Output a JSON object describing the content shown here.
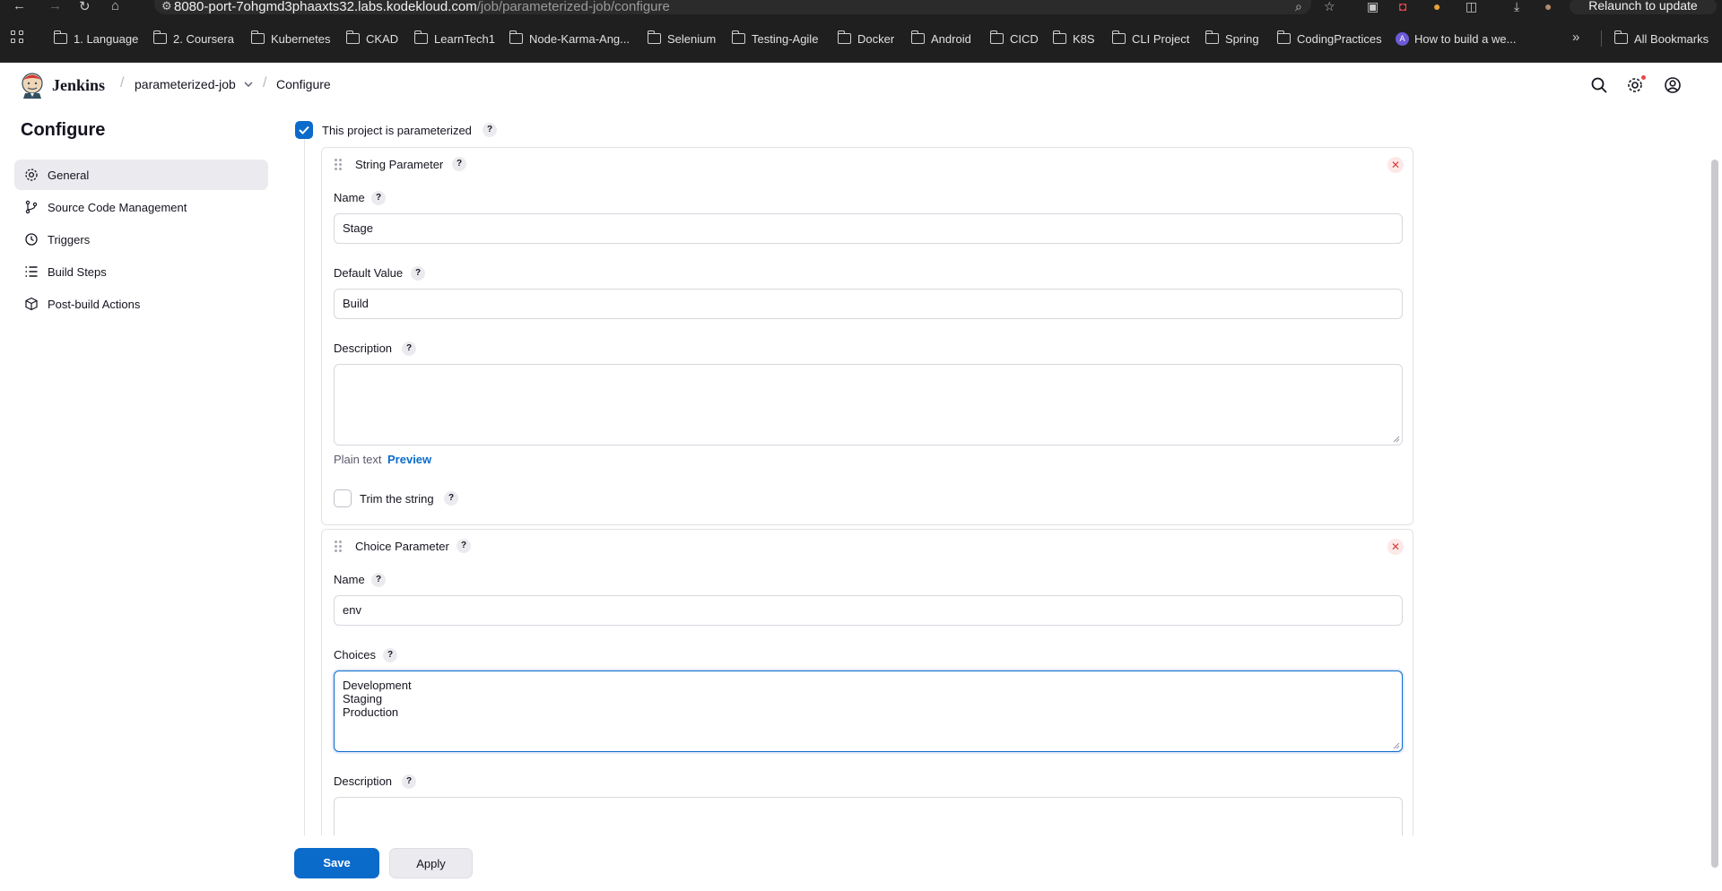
{
  "browser": {
    "url_host": "8080-port-7ohgmd3phaaxts32.labs.kodekloud.com",
    "url_path": "/job/parameterized-job/configure",
    "relaunch_label": "Relaunch to update",
    "bookmarks": [
      {
        "label": "1. Language"
      },
      {
        "label": "2. Coursera"
      },
      {
        "label": "Kubernetes"
      },
      {
        "label": "CKAD"
      },
      {
        "label": "LearnTech1"
      },
      {
        "label": "Node-Karma-Ang..."
      },
      {
        "label": "Selenium"
      },
      {
        "label": "Testing-Agile"
      },
      {
        "label": "Docker"
      },
      {
        "label": "Android"
      },
      {
        "label": "CICD"
      },
      {
        "label": "K8S"
      },
      {
        "label": "CLI Project"
      },
      {
        "label": "Spring"
      },
      {
        "label": "CodingPractices"
      },
      {
        "label": "How to build a we..."
      }
    ],
    "more_label": "»",
    "all_bookmarks_label": "All Bookmarks"
  },
  "header": {
    "brand": "Jenkins",
    "breadcrumb_job": "parameterized-job",
    "breadcrumb_page": "Configure",
    "notification_color": "#e5484d"
  },
  "sidebar": {
    "title": "Configure",
    "items": [
      {
        "label": "General",
        "icon": "gear-icon",
        "active": true
      },
      {
        "label": "Source Code Management",
        "icon": "branch-icon",
        "active": false
      },
      {
        "label": "Triggers",
        "icon": "clock-icon",
        "active": false
      },
      {
        "label": "Build Steps",
        "icon": "list-icon",
        "active": false
      },
      {
        "label": "Post-build Actions",
        "icon": "cube-icon",
        "active": false
      }
    ]
  },
  "main": {
    "parameterized_label": "This project is parameterized",
    "parameterized_checked": true,
    "help_glyph": "?",
    "delete_glyph": "✕",
    "string_param": {
      "title": "String Parameter",
      "name_label": "Name",
      "name_value": "Stage",
      "default_label": "Default Value",
      "default_value": "Build",
      "description_label": "Description",
      "description_value": "",
      "plain_text_label": "Plain text",
      "preview_label": "Preview",
      "trim_label": "Trim the string",
      "trim_checked": false
    },
    "choice_param": {
      "title": "Choice Parameter",
      "name_label": "Name",
      "name_value": "env",
      "choices_label": "Choices",
      "choices_value": "Development\nStaging\nProduction",
      "description_label": "Description",
      "description_value": ""
    }
  },
  "footer": {
    "save_label": "Save",
    "apply_label": "Apply"
  },
  "colors": {
    "accent": "#0b6bcb",
    "link": "#0b6bcb",
    "danger": "#d63a3a"
  }
}
